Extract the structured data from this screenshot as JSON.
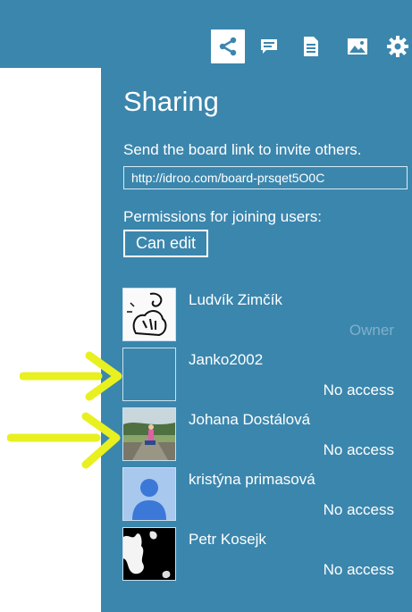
{
  "toolbar": {
    "icons": [
      {
        "name": "share-icon",
        "active": true
      },
      {
        "name": "comment-icon",
        "active": false
      },
      {
        "name": "document-icon",
        "active": false
      },
      {
        "name": "image-icon",
        "active": false
      },
      {
        "name": "gear-icon",
        "active": false
      }
    ]
  },
  "panel": {
    "title": "Sharing",
    "invite_label": "Send the board link to invite others.",
    "link_value": "http://idroo.com/board-prsqet5O0C",
    "permissions_label": "Permissions for joining users:",
    "permissions_value": "Can edit"
  },
  "users": [
    {
      "name": "Ludvík Zimčík",
      "role": "Owner"
    },
    {
      "name": "Janko2002",
      "role": "No access"
    },
    {
      "name": "Johana Dostálová",
      "role": "No access"
    },
    {
      "name": "kristýna primasová",
      "role": "No access"
    },
    {
      "name": "Petr Kosejk",
      "role": "No access"
    }
  ],
  "colors": {
    "panel_bg": "#3b86ad",
    "text": "#ffffff",
    "owner_text": "#7fb0cc",
    "arrow": "#e8f020"
  }
}
